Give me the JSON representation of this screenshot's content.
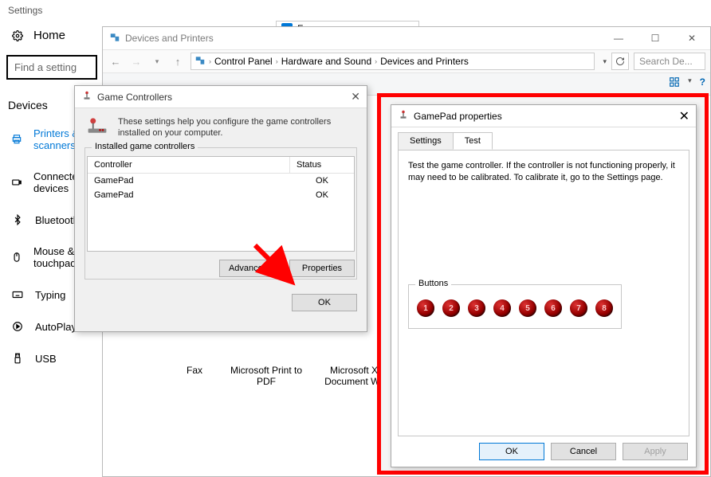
{
  "settings": {
    "app_title": "Settings",
    "home": "Home",
    "search_placeholder": "Find a setting",
    "devices_header": "Devices",
    "nav": [
      {
        "label": "Printers & scanners",
        "id": "printers"
      },
      {
        "label": "Connected devices",
        "id": "connected"
      },
      {
        "label": "Bluetooth",
        "id": "bluetooth"
      },
      {
        "label": "Mouse & touchpad",
        "id": "mouse"
      },
      {
        "label": "Typing",
        "id": "typing"
      },
      {
        "label": "AutoPlay",
        "id": "autoplay"
      },
      {
        "label": "USB",
        "id": "usb"
      }
    ]
  },
  "fax_stub": {
    "title": "Fax"
  },
  "dp": {
    "title": "Devices and Printers",
    "breadcrumb": [
      "Control Panel",
      "Hardware and Sound",
      "Devices and Printers"
    ],
    "search_placeholder": "Search De...",
    "devices": [
      {
        "label": "Fax"
      },
      {
        "label": "Microsoft Print to PDF"
      },
      {
        "label": "Microsoft XPS Document Writer"
      }
    ]
  },
  "gc": {
    "title": "Game Controllers",
    "help": "These settings help you configure the game controllers installed on your computer.",
    "group_label": "Installed game controllers",
    "headers": {
      "controller": "Controller",
      "status": "Status"
    },
    "rows": [
      {
        "name": "GamePad",
        "status": "OK"
      },
      {
        "name": "GamePad",
        "status": "OK"
      }
    ],
    "btn_advanced": "Advanced...",
    "btn_properties": "Properties",
    "btn_ok": "OK"
  },
  "gp": {
    "title": "GamePad properties",
    "tabs": {
      "settings": "Settings",
      "test": "Test"
    },
    "instructions": "Test the game controller.  If the controller is not functioning properly, it may need to be calibrated.  To calibrate it, go to the Settings page.",
    "buttons_label": "Buttons",
    "button_count": 8,
    "btn_ok": "OK",
    "btn_cancel": "Cancel",
    "btn_apply": "Apply"
  },
  "colors": {
    "accent": "#0078d7",
    "highlight": "#ff0000"
  }
}
